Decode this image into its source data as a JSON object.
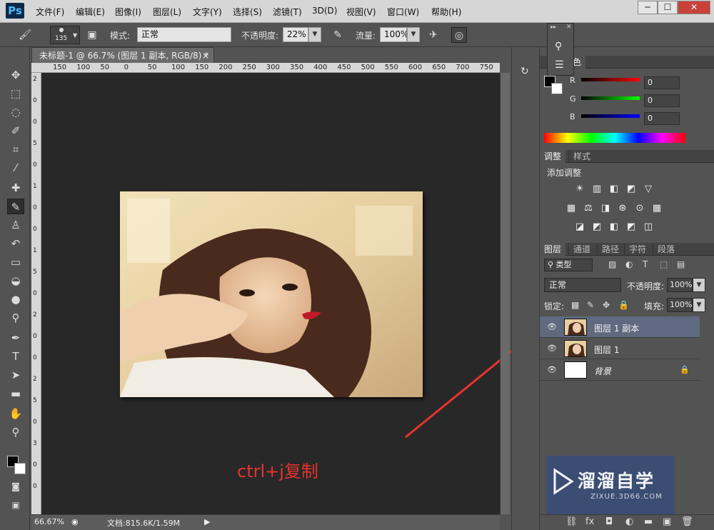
{
  "app": {
    "logo": "Ps"
  },
  "menubar": {
    "items": [
      "文件(F)",
      "编辑(E)",
      "图像(I)",
      "图层(L)",
      "文字(Y)",
      "选择(S)",
      "滤镜(T)",
      "3D(D)",
      "视图(V)",
      "窗口(W)",
      "帮助(H)"
    ],
    "window_buttons": [
      "─",
      "☐",
      "✕"
    ]
  },
  "options": {
    "brush_size": "135",
    "mode_label": "模式:",
    "mode_value": "正常",
    "opacity_label": "不透明度:",
    "opacity_value": "22%",
    "flow_label": "流量:",
    "flow_value": "100%"
  },
  "document": {
    "tab_title": "未标题-1 @ 66.7% (图层 1 副本, RGB/8) *",
    "close": "×"
  },
  "ruler": {
    "top_ticks": [
      "150",
      "100",
      "50",
      "0",
      "50",
      "100",
      "150",
      "200",
      "250",
      "300",
      "350",
      "400",
      "450",
      "500",
      "550",
      "600",
      "650",
      "700",
      "750"
    ],
    "left_ticks": [
      "2",
      "0",
      "0",
      "5",
      "0",
      "1",
      "0",
      "0",
      "1",
      "5",
      "0",
      "2",
      "0",
      "0",
      "2",
      "5",
      "0",
      "3",
      "0",
      "0"
    ]
  },
  "annotation": {
    "text": "ctrl+j复制",
    "color": "#e8332e"
  },
  "status": {
    "zoom": "66.67%",
    "doc": "文档:815.6K/1.59M"
  },
  "color_panel": {
    "tab_label": "颜色",
    "sliders": [
      {
        "label": "R",
        "value": "0"
      },
      {
        "label": "G",
        "value": "0"
      },
      {
        "label": "B",
        "value": "0"
      }
    ]
  },
  "adjust_panel": {
    "tabs": [
      "调整",
      "样式"
    ],
    "title": "添加调整",
    "icons_row1": [
      "☀",
      "▥",
      "◧",
      "◩",
      "▽"
    ],
    "icons_row2": [
      "▦",
      "⚖",
      "◨",
      "⊛",
      "⊙",
      "▦"
    ],
    "icons_row3": [
      "◪",
      "◩",
      "◧",
      "◩",
      "◫"
    ]
  },
  "layers_panel": {
    "tabs": [
      "图层",
      "通道",
      "路径",
      "字符",
      "段落"
    ],
    "filter_label": "类型",
    "blend_mode": "正常",
    "opacity_label": "不透明度:",
    "opacity_value": "100%",
    "lock_label": "锁定:",
    "fill_label": "填充:",
    "fill_value": "100%",
    "layers": [
      {
        "name": "图层 1 副本",
        "selected": true
      },
      {
        "name": "图层 1",
        "selected": false
      },
      {
        "name": "背景",
        "selected": false
      }
    ]
  },
  "watermark": {
    "title": "溜溜自学",
    "subtitle": "ZIXUE.3D66.COM"
  }
}
